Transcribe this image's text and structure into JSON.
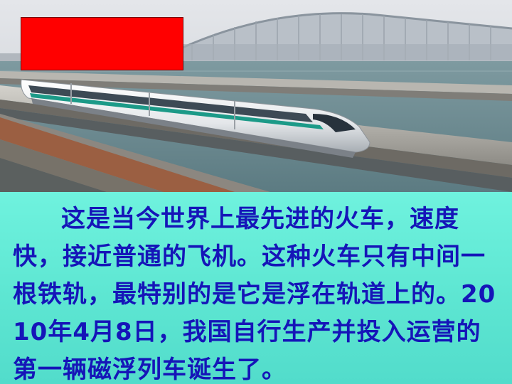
{
  "slide": {
    "body_text": "这是当今世界上最先进的火车，速度快，接近普通的飞机。这种火车只有中间一根铁轨，最特别的是它是浮在轨道上的。2010年4月8日，我国自行生产并投入运营的第一辆磁浮列车诞生了。"
  },
  "colors": {
    "background": "#5fe8d6",
    "text": "#1515b8",
    "red_box": "#ff0000"
  }
}
